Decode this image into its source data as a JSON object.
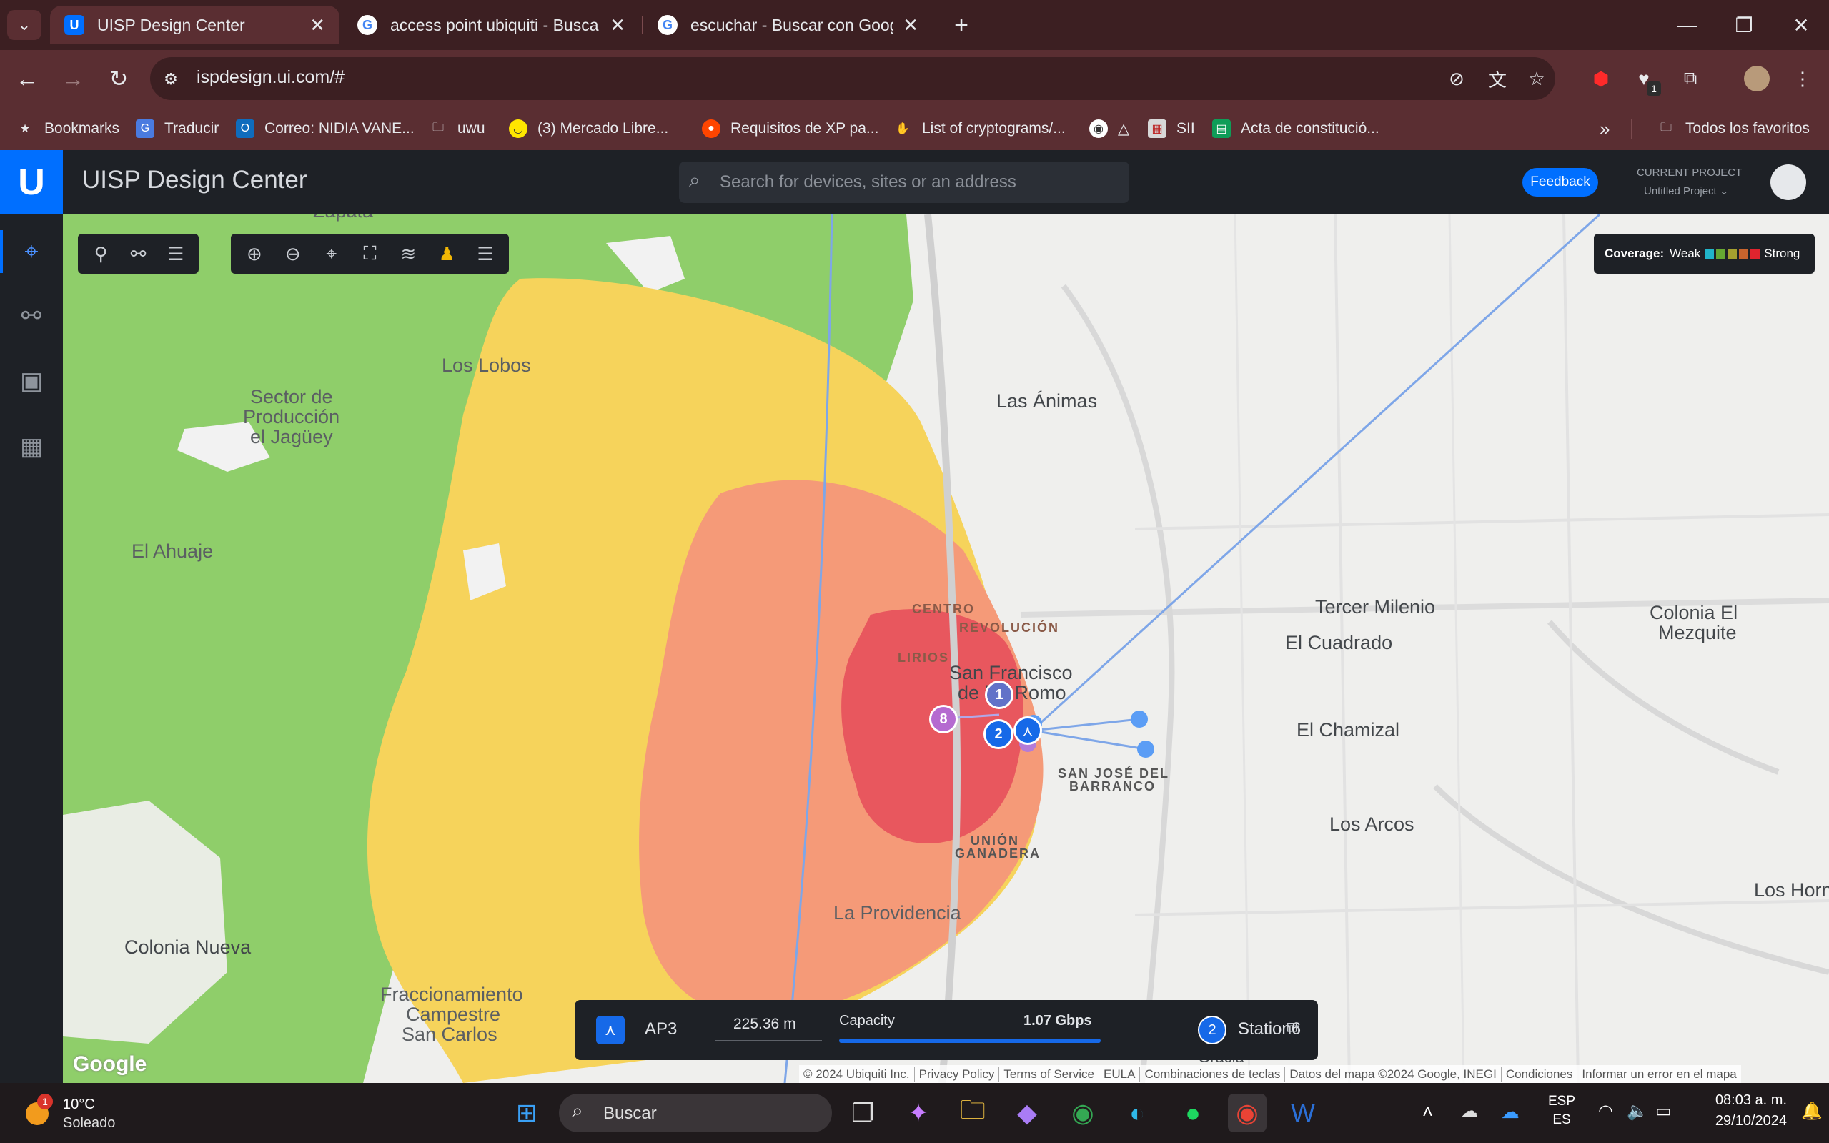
{
  "browser": {
    "tabs": [
      {
        "title": "UISP Design Center",
        "icon": "uisp-favicon"
      },
      {
        "title": "access point ubiquiti - Buscar c",
        "icon": "google-favicon"
      },
      {
        "title": "escuchar - Buscar con Google",
        "icon": "google-favicon"
      }
    ],
    "url": "ispdesign.ui.com/#",
    "extensions_badge": "1",
    "bookmarks": [
      {
        "label": "Bookmarks",
        "icon": "star-icon"
      },
      {
        "label": "Traducir",
        "icon": "translate-icon"
      },
      {
        "label": "Correo: NIDIA VANE...",
        "icon": "outlook-icon"
      },
      {
        "label": "uwu",
        "icon": "folder-icon"
      },
      {
        "label": "(3) Mercado Libre...",
        "icon": "mercadolibre-icon"
      },
      {
        "label": "Requisitos de XP pa...",
        "icon": "reddit-icon"
      },
      {
        "label": "List of cryptograms/...",
        "icon": "hand-icon"
      },
      {
        "label": "△",
        "icon": "eye-icon"
      },
      {
        "label": "SII",
        "icon": "sii-icon"
      },
      {
        "label": "Acta de constitució...",
        "icon": "sheets-icon"
      }
    ],
    "all_bookmarks": "Todos los favoritos"
  },
  "app": {
    "title": "UISP Design Center",
    "search_placeholder": "Search for devices, sites or an address",
    "feedback": "Feedback",
    "project_label": "CURRENT PROJECT",
    "project_name": "Untitled Project"
  },
  "map": {
    "labels": {
      "zapata": "Zapata",
      "los_lobos": "Los Lobos",
      "sector_1": "Sector de",
      "sector_2": "Producción",
      "sector_3": "el Jagüey",
      "el_ahuaje": "El Ahuaje",
      "las_animas": "Las Ánimas",
      "tercer_milenio": "Tercer Milenio",
      "el_cuadrado": "El Cuadrado",
      "colonia_el_1": "Colonia El",
      "colonia_el_2": "Mezquite",
      "centro": "CENTRO",
      "revolucion": "REVOLUCIÓN",
      "lirios": "LIRIOS",
      "sanfran_1": "San Francisco",
      "sanfran_2": "de los Romo",
      "el_chamizal": "El Chamizal",
      "san_jose_1": "SAN JOSÉ DEL",
      "san_jose_2": "BARRANCO",
      "los_arcos": "Los Arcos",
      "union_1": "UNIÓN",
      "union_2": "GANADERA",
      "la_providencia": "La Providencia",
      "colonia_nueva": "Colonia Nueva",
      "frac_1": "Fraccionamiento",
      "frac_2": "Campestre",
      "frac_3": "San Carlos",
      "los_horn": "Los Horn",
      "gracia": "Gracia",
      "google": "Google"
    },
    "markers": {
      "site_8": "8",
      "site_1": "1",
      "site_2": "2"
    },
    "coverage": {
      "label": "Coverage:",
      "weak": "Weak",
      "strong": "Strong",
      "colors": [
        "#21b5c9",
        "#66a832",
        "#a5a02f",
        "#c8642d",
        "#e0242e"
      ]
    },
    "link": {
      "from": "AP3",
      "distance": "225.36 m",
      "capacity_label": "Capacity",
      "capacity_value": "1.07 Gbps",
      "to_badge": "2",
      "to": "Station6"
    },
    "attribution": [
      "© 2024 Ubiquiti Inc.",
      "Privacy Policy",
      "Terms of Service",
      "EULA",
      "Combinaciones de teclas",
      "Datos del mapa ©2024 Google, INEGI",
      "Condiciones",
      "Informar un error en el mapa"
    ]
  },
  "taskbar": {
    "weather_badge": "1",
    "temperature": "10°C",
    "condition": "Soleado",
    "search": "Buscar",
    "lang_1": "ESP",
    "lang_2": "ES",
    "time": "08:03 a. m.",
    "date": "29/10/2024"
  }
}
